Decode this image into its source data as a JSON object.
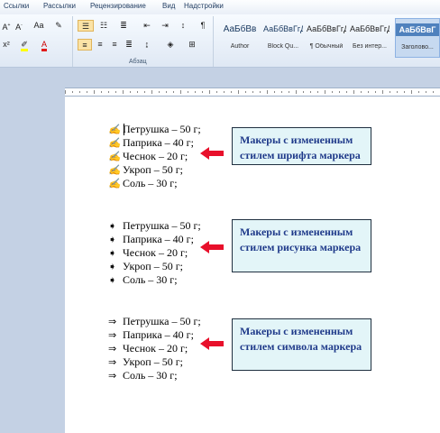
{
  "menu": {
    "tabs": [
      "Ссылки",
      "Рассылки",
      "Рецензирование",
      "Вид",
      "Надстройки"
    ]
  },
  "ribbon": {
    "paragraph_group_label": "Абзац",
    "styles": [
      {
        "sample": "АаБбВв",
        "name": "Author"
      },
      {
        "sample": "АаБбВвГгД",
        "name": "Block Qu..."
      },
      {
        "sample": "АаБбВвГгД",
        "name": "¶ Обычный"
      },
      {
        "sample": "АаБбВвГгД",
        "name": "Без интер..."
      },
      {
        "sample": "АаБбВвГ",
        "name": "Заголово..."
      }
    ]
  },
  "lists": [
    {
      "bullet_style": "font",
      "bullet_glyph": "✍",
      "items": [
        "Петрушка – 50 г;",
        "Паприка – 40 г;",
        "Чеснок – 20 г;",
        "Укроп – 50 г;",
        "Соль – 30 г;"
      ],
      "callout": "Макеры с измененным стилем шрифта маркера"
    },
    {
      "bullet_style": "picture",
      "bullet_glyph": "➧",
      "items": [
        "Петрушка – 50 г;",
        "Паприка – 40 г;",
        "Чеснок – 20 г;",
        "Укроп – 50 г;",
        "Соль – 30 г;"
      ],
      "callout": "Макеры с измененным стилем рисунка маркера"
    },
    {
      "bullet_style": "symbol",
      "bullet_glyph": "⇒",
      "items": [
        "Петрушка – 50 г;",
        "Паприка – 40 г;",
        "Чеснок – 20 г;",
        "Укроп – 50 г;",
        "Соль – 30 г;"
      ],
      "callout": "Макеры с измененным стилем символа маркера"
    }
  ],
  "colors": {
    "arrow": "#e8102b",
    "callout_bg": "#e3f5f8",
    "callout_text": "#1f3a8a",
    "doc_bg": "#c4d1e4"
  }
}
